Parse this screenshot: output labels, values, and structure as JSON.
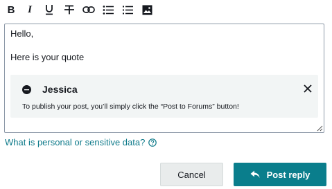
{
  "toolbar": {
    "bold_glyph": "B",
    "italic_glyph": "I",
    "icons": [
      "bold-icon",
      "italic-icon",
      "underline-icon",
      "strikethrough-icon",
      "link-icon",
      "bulleted-list-icon",
      "numbered-list-icon",
      "image-icon"
    ]
  },
  "editor": {
    "line1": "Hello,",
    "line2": "Here is your quote"
  },
  "quote": {
    "author": "Jessica",
    "body": "To publish your post, you’ll simply click the “Post to Forums” button!"
  },
  "help_link": {
    "label": "What is personal or sensitive data?",
    "color": "#0e7a8a"
  },
  "buttons": {
    "cancel_label": "Cancel",
    "post_label": "Post reply",
    "post_color": "#0a7e8c"
  }
}
